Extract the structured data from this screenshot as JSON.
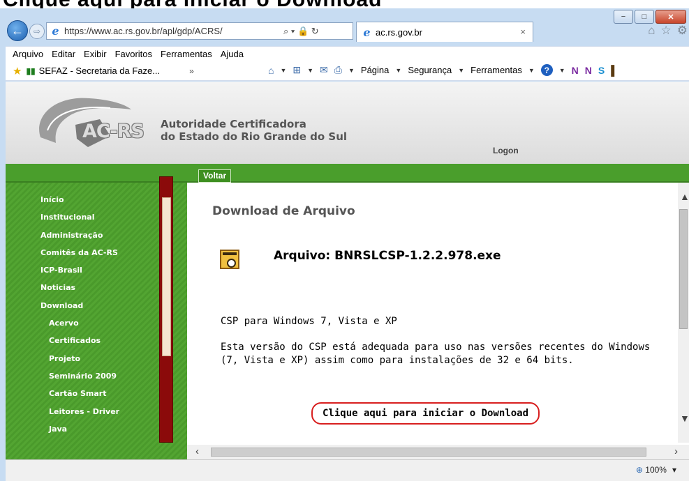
{
  "caption": "Clique aqui para iniciar o Download",
  "window": {
    "minimize": "−",
    "maximize": "□",
    "close": "✕"
  },
  "browser": {
    "back_icon": "←",
    "forward_icon": "⇨",
    "url": "https://www.ac.rs.gov.br/apl/gdp/ACRS/",
    "url_icons": "⌕ ▾ 🔒 ↻",
    "tab_title": "ac.rs.gov.br",
    "tab_close": "×",
    "home_icon": "⌂",
    "favorites_icon": "☆",
    "settings_icon": "⚙"
  },
  "menu": [
    "Arquivo",
    "Editar",
    "Exibir",
    "Favoritos",
    "Ferramentas",
    "Ajuda"
  ],
  "favorites_bar": {
    "item": "SEFAZ - Secretaria da Faze...",
    "chevron": "»"
  },
  "command_bar": {
    "pagina": "Página",
    "seguranca": "Segurança",
    "ferramentas": "Ferramentas",
    "help": "?"
  },
  "header": {
    "logo_text": "AC-RS",
    "authority_line1": "Autoridade Certificadora",
    "authority_line2": "do Estado do Rio Grande do Sul",
    "logon": "Logon"
  },
  "toolbar": {
    "voltar": "Voltar"
  },
  "sidebar": {
    "items": [
      {
        "label": "Início",
        "sub": false
      },
      {
        "label": "Institucional",
        "sub": false
      },
      {
        "label": "Administração",
        "sub": false
      },
      {
        "label": "Comitês da AC-RS",
        "sub": false
      },
      {
        "label": "ICP-Brasil",
        "sub": false
      },
      {
        "label": "Noticias",
        "sub": false
      },
      {
        "label": "Download",
        "sub": false
      },
      {
        "label": "Acervo",
        "sub": true
      },
      {
        "label": "Certificados",
        "sub": true
      },
      {
        "label": "Projeto",
        "sub": true
      },
      {
        "label": "Seminário 2009",
        "sub": true
      },
      {
        "label": "Cartão Smart",
        "sub": true
      },
      {
        "label": "Leitores - Driver",
        "sub": true
      },
      {
        "label": "Java",
        "sub": true
      }
    ]
  },
  "main": {
    "title": "Download de Arquivo",
    "file_title": "Arquivo: BNRSLCSP-1.2.2.978.exe",
    "desc1": "CSP para Windows 7, Vista e XP",
    "desc2_line1": "Esta versão do CSP está adequada para uso nas versões recentes do Windows",
    "desc2_line2": "(7, Vista e XP) assim como para instalações de 32 e 64 bits.",
    "download_link": "Clique aqui para iniciar o Download"
  },
  "status": {
    "zoom": "100%",
    "zoom_dd": "▾"
  }
}
